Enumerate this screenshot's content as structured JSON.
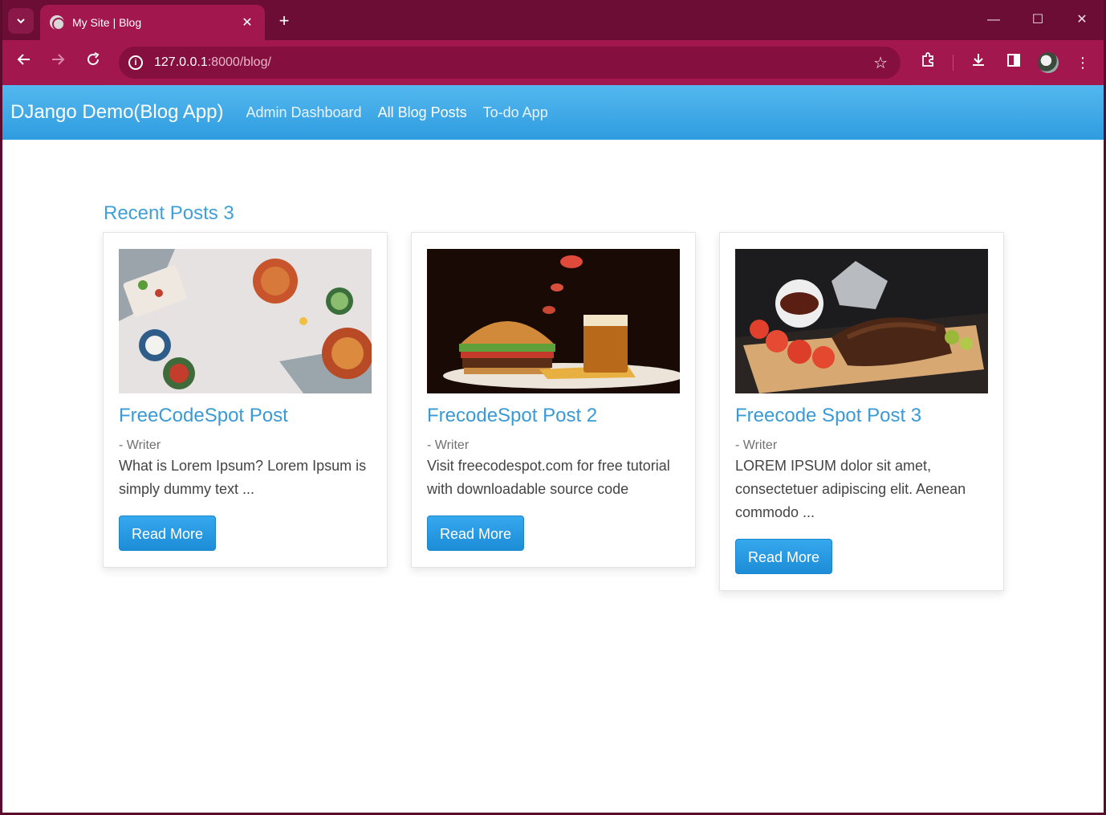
{
  "browser": {
    "tab_title": "My Site | Blog",
    "url_host": "127.0.0.1",
    "url_path": ":8000/blog/"
  },
  "navbar": {
    "brand": "DJango Demo(Blog App)",
    "links": [
      {
        "label": "Admin Dashboard"
      },
      {
        "label": "All Blog Posts"
      },
      {
        "label": "To-do App"
      }
    ]
  },
  "section_title": "Recent Posts 3",
  "posts": [
    {
      "title": "FreeCodeSpot Post",
      "author": "- Writer",
      "excerpt": "What is Lorem Ipsum? Lorem Ipsum is simply dummy text ...",
      "button": "Read More",
      "image": "food-bowls-photo"
    },
    {
      "title": "FrecodeSpot Post 2",
      "author": "- Writer",
      "excerpt": "Visit freecodespot.com for free tutorial with downloadable source code",
      "button": "Read More",
      "image": "burger-beer-photo"
    },
    {
      "title": "Freecode Spot Post 3",
      "author": "- Writer",
      "excerpt": "LOREM IPSUM dolor sit amet, consectetuer adipiscing elit. Aenean commodo ...",
      "button": "Read More",
      "image": "ribs-platter-photo"
    }
  ],
  "colors": {
    "accent": "#3a9ad6",
    "navbar": "#2f9ce0",
    "browser_frame": "#a3174f"
  }
}
